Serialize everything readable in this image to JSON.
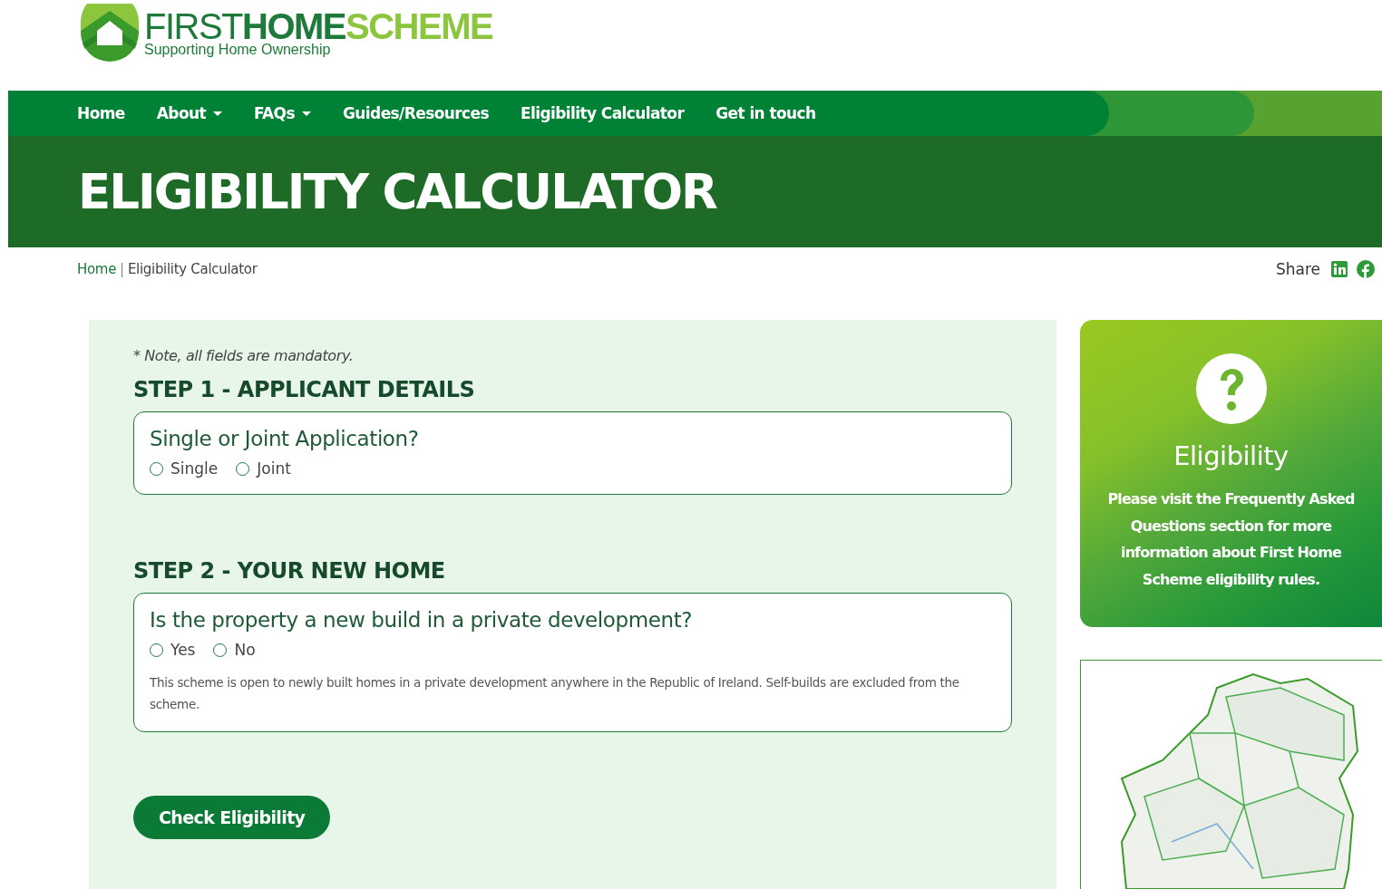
{
  "logo": {
    "parts": [
      "FIRST",
      "HOME",
      "SCHEME"
    ],
    "tagline": "Supporting Home Ownership"
  },
  "nav": [
    {
      "label": "Home",
      "dropdown": false
    },
    {
      "label": "About",
      "dropdown": true
    },
    {
      "label": "FAQs",
      "dropdown": true
    },
    {
      "label": "Guides/Resources",
      "dropdown": false
    },
    {
      "label": "Eligibility Calculator",
      "dropdown": false
    },
    {
      "label": "Get in touch",
      "dropdown": false
    }
  ],
  "page_title": "ELIGIBILITY CALCULATOR",
  "breadcrumb": {
    "link": "Home",
    "separator": "|",
    "current": "Eligibility Calculator"
  },
  "share": {
    "label": "Share"
  },
  "form": {
    "note": "* Note, all fields are mandatory.",
    "steps": [
      {
        "heading": "STEP 1 - APPLICANT DETAILS",
        "question": "Single or Joint Application?",
        "options": [
          {
            "label": "Single",
            "selected": false
          },
          {
            "label": "Joint",
            "selected": false
          }
        ]
      },
      {
        "heading": "STEP 2 - YOUR NEW HOME",
        "question": "Is the property a new build in a private development?",
        "options": [
          {
            "label": "Yes",
            "selected": false
          },
          {
            "label": "No",
            "selected": false
          }
        ],
        "help": "This scheme is open to newly built homes in a private development anywhere in the Republic of Ireland. Self-builds are excluded from the scheme."
      }
    ],
    "submit": "Check Eligibility"
  },
  "info_card": {
    "title": "Eligibility",
    "text": "Please visit the Frequently Asked Questions section for more information about First Home Scheme eligibility rules."
  }
}
